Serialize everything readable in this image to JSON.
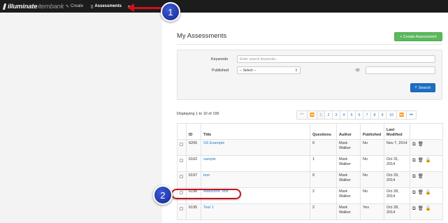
{
  "brand": {
    "name_bold": "illuminate",
    "name_light": "itembank"
  },
  "nav": {
    "create_label": "Create",
    "assessments_label": "Assessments",
    "more_label": "▾"
  },
  "callouts": {
    "badge_1": "1",
    "badge_2": "2"
  },
  "page": {
    "title": "My Assessments",
    "create_button": "+ Create Assessment"
  },
  "search": {
    "keywords_label": "Keywords",
    "keywords_placeholder": "Enter search keywords...",
    "published_label": "Published",
    "published_value": "-- Select --",
    "id_label": "ID",
    "id_value": "",
    "search_button": "Search"
  },
  "results": {
    "display_text": "Displaying 1 to 10 of 195",
    "pages": [
      "⏮",
      "⏪",
      "1",
      "2",
      "3",
      "4",
      "5",
      "6",
      "7",
      "8",
      "9",
      "10",
      "⏩",
      "⏭"
    ]
  },
  "table": {
    "headers": {
      "id": "ID",
      "title": "Title",
      "questions": "Questions",
      "author": "Author",
      "published": "Published",
      "modified": "Last Modified"
    },
    "rows": [
      {
        "id": "6205",
        "title": "SS Example",
        "questions": "0",
        "author": "Mark Walker",
        "published": "No",
        "modified": "Nov 7, 2014",
        "lock": false
      },
      {
        "id": "6162",
        "title": "sample",
        "questions": "1",
        "author": "Mark Walker",
        "published": "No",
        "modified": "Oct 31, 2014",
        "lock": true
      },
      {
        "id": "6197",
        "title": "test",
        "questions": "0",
        "author": "Mark Walker",
        "published": "No",
        "modified": "Oct 29, 2014",
        "lock": false
      },
      {
        "id": "6196",
        "title": "Awesome Test",
        "questions": "2",
        "author": "Mark Walker",
        "published": "No",
        "modified": "Oct 28, 2014",
        "lock": true
      },
      {
        "id": "6195",
        "title": "Test 1",
        "questions": "2",
        "author": "Mark Walker",
        "published": "Yes",
        "modified": "Oct 28, 2014",
        "lock": true
      }
    ]
  },
  "icons": {
    "copy": "copy-icon",
    "delete": "trash-icon",
    "lock": "unlock-icon"
  },
  "colors": {
    "topbar": "#1c1c1c",
    "accent_green": "#5cb85c",
    "accent_blue": "#1a6fc4",
    "link": "#2a7bc8",
    "callout_red": "#d0101b",
    "callout_badge": "#1f35a8"
  }
}
